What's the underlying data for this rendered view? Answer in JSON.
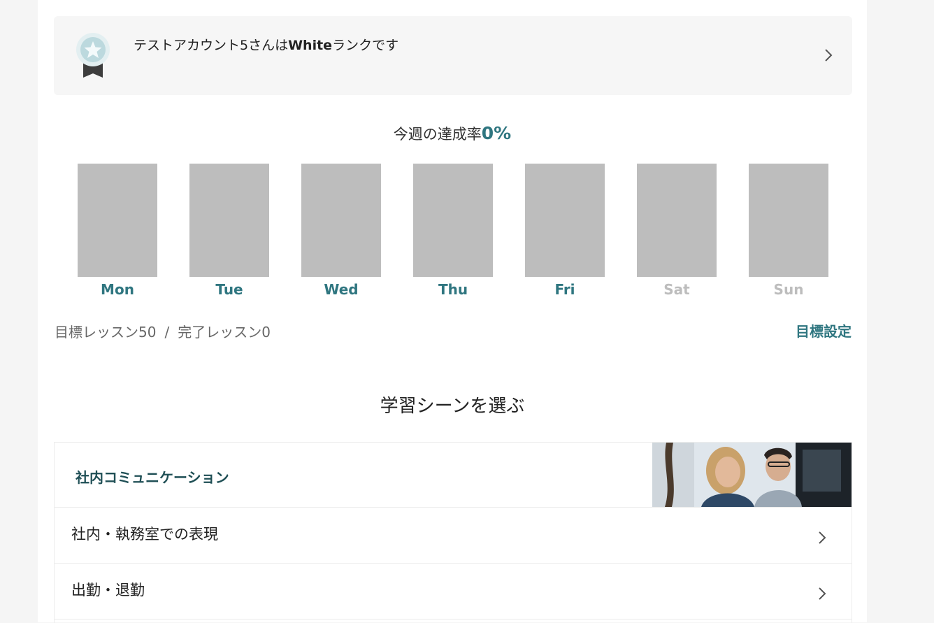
{
  "rank": {
    "name_prefix": "テストアカウント5さんは",
    "rank_name": "White",
    "rank_suffix": "ランクです",
    "icon": "medal-icon"
  },
  "weekly": {
    "label": "今週の達成率",
    "rate": "0%",
    "days": [
      {
        "label": "Mon",
        "weekend": false,
        "progress": 0
      },
      {
        "label": "Tue",
        "weekend": false,
        "progress": 0
      },
      {
        "label": "Wed",
        "weekend": false,
        "progress": 0
      },
      {
        "label": "Thu",
        "weekend": false,
        "progress": 0
      },
      {
        "label": "Fri",
        "weekend": false,
        "progress": 0
      },
      {
        "label": "Sat",
        "weekend": true,
        "progress": 0
      },
      {
        "label": "Sun",
        "weekend": true,
        "progress": 0
      }
    ],
    "target_lessons": "目標レッスン50",
    "separator": "/",
    "completed_lessons": "完了レッスン0",
    "goal_setting": "目標設定"
  },
  "scenes": {
    "title": "学習シーンを選ぶ",
    "category": "社内コミュニケーション",
    "items": [
      {
        "label": "社内・執務室での表現"
      },
      {
        "label": "出勤・退勤"
      }
    ]
  },
  "colors": {
    "accent": "#2f7680",
    "bar": "#bdbdbd",
    "card_bg": "#f6f6f6"
  }
}
